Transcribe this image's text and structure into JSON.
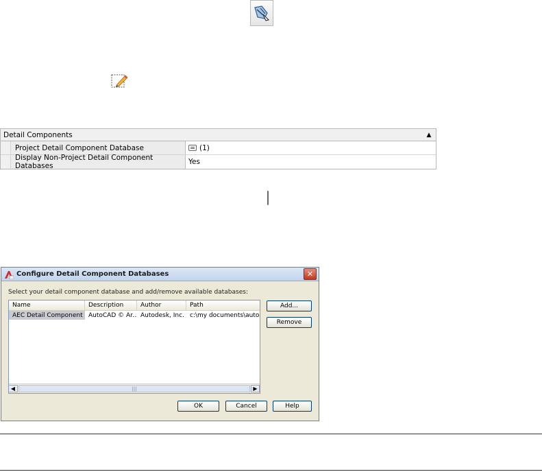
{
  "icons": {
    "tool_palette": "component-tool-icon",
    "edit_component": "edit-pencil-icon",
    "list_button": "list-browse-icon"
  },
  "palette": {
    "header": "Detail Components",
    "rows": [
      {
        "label": "Project Detail Component Database",
        "value": "(1)"
      },
      {
        "label": "Display Non-Project Detail Component Databases",
        "value": "Yes"
      }
    ]
  },
  "dialog": {
    "title": "Configure Detail Component Databases",
    "instruction": "Select your detail component database and add/remove available databases:",
    "columns": [
      "Name",
      "Description",
      "Author",
      "Path"
    ],
    "rows": [
      [
        "AEC Detail Component ...",
        "AutoCAD © Ar...",
        "Autodesk, Inc.",
        "c:\\my documents\\auto..."
      ]
    ],
    "buttons": {
      "add": "Add...",
      "remove": "Remove",
      "ok": "OK",
      "cancel": "Cancel",
      "help": "Help"
    }
  }
}
